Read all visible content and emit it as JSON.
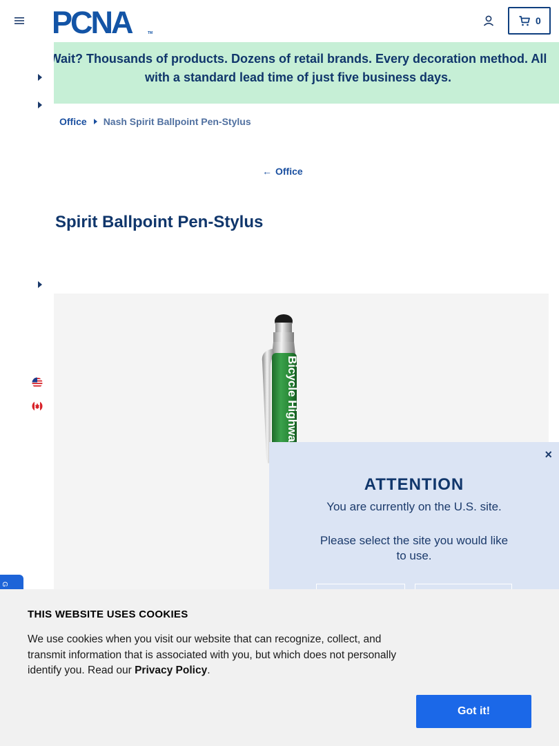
{
  "header": {
    "logo_text": "PCNA",
    "logo_tm": "TM",
    "cart_count": "0",
    "menu_icon": "hamburger-icon",
    "account_icon": "user-icon",
    "cart_icon": "cart-icon"
  },
  "banner": {
    "text": "Wait? Thousands of products. Dozens of retail brands. Every decoration method. All with a standard lead time of just five business days."
  },
  "breadcrumb": {
    "items": [
      "Office",
      "Nash Spirit Ballpoint Pen-Stylus"
    ]
  },
  "back_link": {
    "label": "Office"
  },
  "product": {
    "title": "Spirit Ballpoint Pen-Stylus",
    "imprint_text": "Bicycle Highways"
  },
  "sidebar": {
    "flags": [
      "us-flag-icon",
      "canada-flag-icon"
    ]
  },
  "feedback": {
    "label": "G"
  },
  "attention": {
    "close": "×",
    "title": "ATTENTION",
    "line1": "You are currently on the U.S. site.",
    "line2": "Please select the site you would like to use."
  },
  "cookie": {
    "title": "THIS WEBSITE USES COOKIES",
    "text_before": "We use cookies when you visit our website that can recognize, collect, and transmit information that is associated with you, but which does not personally identify you. Read our ",
    "link": "Privacy Policy",
    "text_after": ".",
    "button": "Got it!"
  },
  "colors": {
    "brand_navy": "#10366b",
    "banner_bg": "#c6efd6",
    "cookie_button": "#1b68e8",
    "modal_bg": "#dbe4f4",
    "pen_green": "#2e8a3e"
  }
}
